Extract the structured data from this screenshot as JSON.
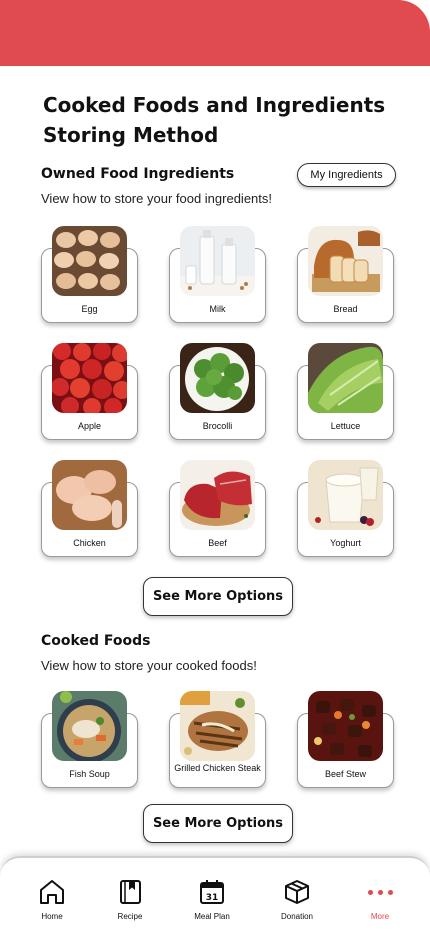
{
  "page": {
    "title": "Cooked Foods and Ingredients Storing Method"
  },
  "owned": {
    "title": "Owned Food Ingredients",
    "subtitle": "View how to store your food ingredients!",
    "my_ingredients_label": "My Ingredients",
    "items": [
      {
        "label": "Egg"
      },
      {
        "label": "Milk"
      },
      {
        "label": "Bread"
      },
      {
        "label": "Apple"
      },
      {
        "label": "Brocolli"
      },
      {
        "label": "Lettuce"
      },
      {
        "label": "Chicken"
      },
      {
        "label": "Beef"
      },
      {
        "label": "Yoghurt"
      }
    ],
    "see_more_label": "See More Options"
  },
  "cooked": {
    "title": "Cooked Foods",
    "subtitle": "View how to store your cooked foods!",
    "items": [
      {
        "label": "Fish Soup"
      },
      {
        "label": "Grilled Chicken Steak"
      },
      {
        "label": "Beef Stew"
      }
    ],
    "see_more_label": "See More Options"
  },
  "nav": {
    "items": [
      {
        "label": "Home",
        "icon": "home-icon"
      },
      {
        "label": "Recipe",
        "icon": "book-icon"
      },
      {
        "label": "Meal Plan",
        "icon": "calendar-icon",
        "calendar_day": "31"
      },
      {
        "label": "Donation",
        "icon": "box-icon"
      },
      {
        "label": "More",
        "icon": "more-dots-icon"
      }
    ],
    "active_color": "#e04b50"
  },
  "theme": {
    "accent": "#e04b50"
  }
}
